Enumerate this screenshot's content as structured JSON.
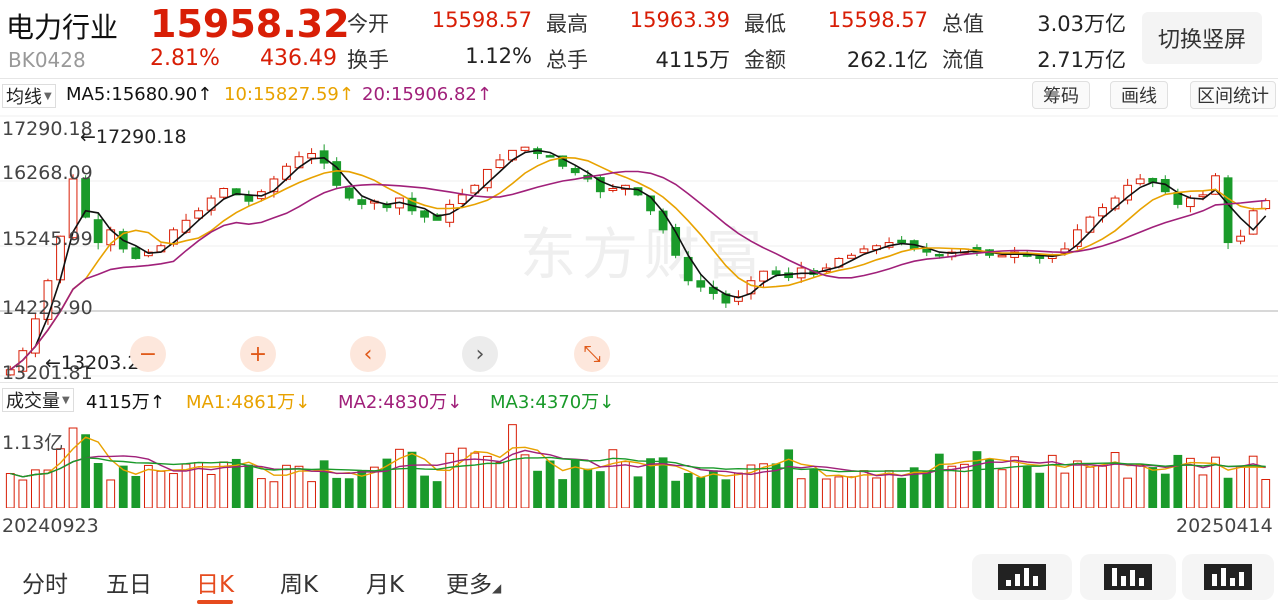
{
  "header": {
    "name": "电力行业",
    "price": "15958.32",
    "code": "BK0428",
    "change_pct": "2.81%",
    "change_amt": "436.49",
    "stats": [
      {
        "label": "今开",
        "value": "15598.57",
        "color": "red"
      },
      {
        "label": "最高",
        "value": "15963.39",
        "color": "red"
      },
      {
        "label": "最低",
        "value": "15598.57",
        "color": "red"
      },
      {
        "label": "总值",
        "value": "3.03万亿",
        "color": "dark"
      },
      {
        "label": "换手",
        "value": "1.12%",
        "color": "dark"
      },
      {
        "label": "总手",
        "value": "4115万",
        "color": "dark"
      },
      {
        "label": "金额",
        "value": "262.1亿",
        "color": "dark"
      },
      {
        "label": "流值",
        "value": "2.71万亿",
        "color": "dark"
      }
    ],
    "switch_label": "切换竖屏"
  },
  "price_indicators": {
    "selector": "均线",
    "ma5": "MA5:15680.90",
    "ma10": "10:15827.59",
    "ma20": "20:15906.82",
    "arrow": "↑"
  },
  "tools": [
    "筹码",
    "画线",
    "区间统计"
  ],
  "price_axis": [
    "17290.18",
    "16268.09",
    "15245.99",
    "14223.90",
    "13201.81"
  ],
  "annotations": {
    "high": "←17290.18",
    "low": "←13203.29"
  },
  "watermark": "东方财富",
  "controls": [
    "−",
    "+",
    "‹",
    "›",
    "⤡"
  ],
  "volume_indicators": {
    "selector": "成交量",
    "vol": "4115万",
    "vol_arrow": "↑",
    "ma1": "MA1:4861万",
    "ma1_arrow": "↓",
    "ma2": "MA2:4830万",
    "ma2_arrow": "↓",
    "ma3": "MA3:4370万",
    "ma3_arrow": "↓"
  },
  "volume_axis_top": "1.13亿",
  "dates": {
    "start": "20240923",
    "end": "20250414"
  },
  "tabs": [
    {
      "label": "分时",
      "active": false
    },
    {
      "label": "五日",
      "active": false
    },
    {
      "label": "日K",
      "active": true
    },
    {
      "label": "周K",
      "active": false
    },
    {
      "label": "月K",
      "active": false
    },
    {
      "label": "更多",
      "active": false
    }
  ],
  "colors": {
    "up": "#d81e06",
    "down": "#1a9a2a",
    "ma5": "#111111",
    "ma10": "#e8a200",
    "ma20": "#a0207a",
    "ma3": "#1a9a2a"
  },
  "chart_data": {
    "type": "candlestick",
    "x_range": [
      "20240923",
      "20250414"
    ],
    "y_range": [
      13201.81,
      17290.18
    ],
    "close_series": [
      13300,
      13600,
      14100,
      14700,
      15400,
      16300,
      15700,
      15300,
      15500,
      15200,
      15050,
      15150,
      15250,
      15500,
      15650,
      15800,
      16000,
      16150,
      16050,
      15950,
      16100,
      16300,
      16500,
      16650,
      16700,
      16550,
      16200,
      16000,
      15900,
      15950,
      15850,
      16000,
      15800,
      15700,
      15650,
      15900,
      16050,
      16200,
      16450,
      16600,
      16750,
      16800,
      16700,
      16650,
      16500,
      16400,
      16300,
      16100,
      16150,
      16200,
      16050,
      15800,
      15500,
      15100,
      14700,
      14600,
      14500,
      14350,
      14450,
      14700,
      14850,
      14800,
      14750,
      14900,
      14800,
      14900,
      15050,
      15100,
      15200,
      15250,
      15300,
      15300,
      15200,
      15150,
      15100,
      15150,
      15200,
      15150,
      15100,
      15100,
      15150,
      15100,
      15050,
      15100,
      15200,
      15500,
      15700,
      15850,
      16000,
      16200,
      16300,
      16250,
      16100,
      15900,
      16000,
      16050,
      16350,
      15300,
      15400,
      15800,
      15960
    ]
  }
}
